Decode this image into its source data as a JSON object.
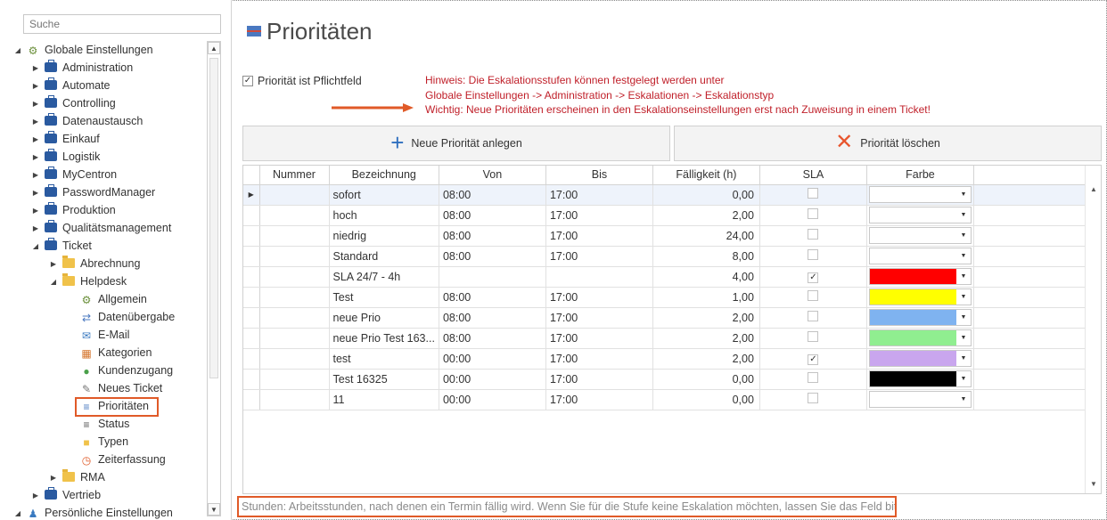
{
  "sidebar": {
    "search_placeholder": "Suche",
    "tree": [
      {
        "label": "Globale Einstellungen",
        "depth": 0,
        "expanded": true,
        "icon": "gears-icon"
      },
      {
        "label": "Administration",
        "depth": 1,
        "icon": "briefcase-icon"
      },
      {
        "label": "Automate",
        "depth": 1,
        "icon": "briefcase-icon"
      },
      {
        "label": "Controlling",
        "depth": 1,
        "icon": "briefcase-icon"
      },
      {
        "label": "Datenaustausch",
        "depth": 1,
        "icon": "briefcase-icon"
      },
      {
        "label": "Einkauf",
        "depth": 1,
        "icon": "briefcase-icon"
      },
      {
        "label": "Logistik",
        "depth": 1,
        "icon": "briefcase-icon"
      },
      {
        "label": "MyCentron",
        "depth": 1,
        "icon": "briefcase-icon"
      },
      {
        "label": "PasswordManager",
        "depth": 1,
        "icon": "briefcase-icon"
      },
      {
        "label": "Produktion",
        "depth": 1,
        "icon": "briefcase-icon"
      },
      {
        "label": "Qualitätsmanagement",
        "depth": 1,
        "icon": "briefcase-icon"
      },
      {
        "label": "Ticket",
        "depth": 1,
        "expanded": true,
        "icon": "briefcase-icon"
      },
      {
        "label": "Abrechnung",
        "depth": 2,
        "icon": "folder-icon"
      },
      {
        "label": "Helpdesk",
        "depth": 2,
        "expanded": true,
        "icon": "folder-icon"
      },
      {
        "label": "Allgemein",
        "depth": 3,
        "icon": "gears-icon"
      },
      {
        "label": "Datenübergabe",
        "depth": 3,
        "icon": "transfer-icon"
      },
      {
        "label": "E-Mail",
        "depth": 3,
        "icon": "mail-icon"
      },
      {
        "label": "Kategorien",
        "depth": 3,
        "icon": "categories-icon"
      },
      {
        "label": "Kundenzugang",
        "depth": 3,
        "icon": "user-icon"
      },
      {
        "label": "Neues Ticket",
        "depth": 3,
        "icon": "ticket-icon"
      },
      {
        "label": "Prioritäten",
        "depth": 3,
        "icon": "priorities-icon",
        "selected": true
      },
      {
        "label": "Status",
        "depth": 3,
        "icon": "list-icon"
      },
      {
        "label": "Typen",
        "depth": 3,
        "icon": "folder-small-icon"
      },
      {
        "label": "Zeiterfassung",
        "depth": 3,
        "icon": "stopwatch-icon"
      },
      {
        "label": "RMA",
        "depth": 2,
        "icon": "folder-icon"
      },
      {
        "label": "Vertrieb",
        "depth": 1,
        "icon": "briefcase-icon"
      },
      {
        "label": "Persönliche Einstellungen",
        "depth": 0,
        "expanded": true,
        "icon": "user-settings-icon"
      }
    ]
  },
  "main": {
    "title": "Prioritäten",
    "mandatory_label": "Priorität ist Pflichtfeld",
    "mandatory_checked": true,
    "hint_lines": [
      "Hinweis: Die Eskalationsstufen können festgelegt werden unter",
      "Globale Einstellungen -> Administration -> Eskalationen -> Eskalationstyp",
      "Wichtig: Neue Prioritäten erscheinen in den Eskalationseinstellungen erst nach Zuweisung in einem Ticket!"
    ],
    "new_button": "Neue Priorität anlegen",
    "delete_button": "Priorität löschen",
    "columns": [
      "Nummer",
      "Bezeichnung",
      "Von",
      "Bis",
      "Fälligkeit (h)",
      "SLA",
      "Farbe"
    ],
    "rows": [
      {
        "nummer": "",
        "bezeichnung": "sofort",
        "von": "08:00",
        "bis": "17:00",
        "faelligkeit": "0,00",
        "sla": false,
        "farbe": ""
      },
      {
        "nummer": "",
        "bezeichnung": "hoch",
        "von": "08:00",
        "bis": "17:00",
        "faelligkeit": "2,00",
        "sla": false,
        "farbe": ""
      },
      {
        "nummer": "",
        "bezeichnung": "niedrig",
        "von": "08:00",
        "bis": "17:00",
        "faelligkeit": "24,00",
        "sla": false,
        "farbe": ""
      },
      {
        "nummer": "",
        "bezeichnung": "Standard",
        "von": "08:00",
        "bis": "17:00",
        "faelligkeit": "8,00",
        "sla": false,
        "farbe": ""
      },
      {
        "nummer": "",
        "bezeichnung": "SLA 24/7 - 4h",
        "von": "",
        "bis": "",
        "faelligkeit": "4,00",
        "sla": true,
        "farbe": "#ff0000"
      },
      {
        "nummer": "",
        "bezeichnung": "Test",
        "von": "08:00",
        "bis": "17:00",
        "faelligkeit": "1,00",
        "sla": false,
        "farbe": "#ffff00"
      },
      {
        "nummer": "",
        "bezeichnung": "neue Prio",
        "von": "08:00",
        "bis": "17:00",
        "faelligkeit": "2,00",
        "sla": false,
        "farbe": "#7fb3f0"
      },
      {
        "nummer": "",
        "bezeichnung": "neue Prio Test 163...",
        "von": "08:00",
        "bis": "17:00",
        "faelligkeit": "2,00",
        "sla": false,
        "farbe": "#90ee90"
      },
      {
        "nummer": "",
        "bezeichnung": "test",
        "von": "00:00",
        "bis": "17:00",
        "faelligkeit": "2,00",
        "sla": true,
        "farbe": "#c9a6ee"
      },
      {
        "nummer": "",
        "bezeichnung": "Test 16325",
        "von": "00:00",
        "bis": "17:00",
        "faelligkeit": "0,00",
        "sla": false,
        "farbe": "#000000"
      },
      {
        "nummer": "",
        "bezeichnung": "11",
        "von": "00:00",
        "bis": "17:00",
        "faelligkeit": "0,00",
        "sla": false,
        "farbe": ""
      }
    ],
    "footer_note": "Stunden: Arbeitsstunden, nach denen ein Termin fällig wird. Wenn Sie für die Stufe keine Eskalation möchten, lassen Sie das Feld bitte leer.",
    "colors": {
      "accent_red": "#c0202a",
      "callout": "#e05a28",
      "plus_blue": "#2f6fbf",
      "x_red": "#e8552d"
    }
  }
}
